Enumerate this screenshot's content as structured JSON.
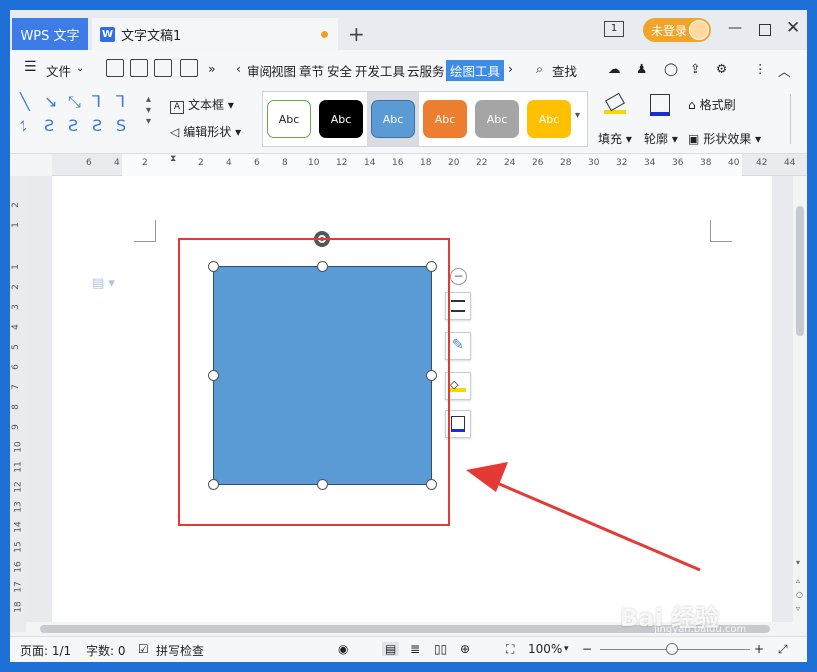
{
  "titlebar": {
    "app_tab": "WPS 文字",
    "doc_tab": "文字文稿1",
    "new_tab": "+",
    "page_count_icon": "1",
    "login": "未登录"
  },
  "menu": {
    "file": "文件",
    "items": [
      "审阅",
      "视图",
      "章节",
      "安全",
      "开发工具",
      "云服务",
      "绘图工具"
    ],
    "search": "查找"
  },
  "ribbon": {
    "textbox": "文本框",
    "edit_shape": "编辑形状",
    "style_label": "Abc",
    "fill": "填充",
    "outline": "轮廓",
    "format_painter": "格式刷",
    "shape_effects": "形状效果"
  },
  "ruler": {
    "h_ticks": [
      "6",
      "4",
      "2",
      "2",
      "4",
      "6",
      "8",
      "10",
      "12",
      "14",
      "16",
      "18",
      "20",
      "22",
      "24",
      "26",
      "28",
      "30",
      "32",
      "34",
      "36",
      "38",
      "40",
      "42",
      "44"
    ],
    "v_ticks": [
      "2",
      "1",
      "1",
      "2",
      "3",
      "4",
      "5",
      "6",
      "7",
      "8",
      "9",
      "10",
      "11",
      "12",
      "13",
      "14",
      "15",
      "16",
      "17",
      "18"
    ]
  },
  "status": {
    "page": "页面: 1/1",
    "words": "字数: 0",
    "spell": "拼写检查",
    "zoom": "100%",
    "zoom_minus": "−",
    "zoom_plus": "+"
  },
  "watermark": {
    "text": "Bai 经验",
    "sub": "jingyan.baidu.com"
  },
  "colors": {
    "shape_fill": "#5b9bd5",
    "highlight_box": "#e53935",
    "arrow": "#e53935"
  }
}
